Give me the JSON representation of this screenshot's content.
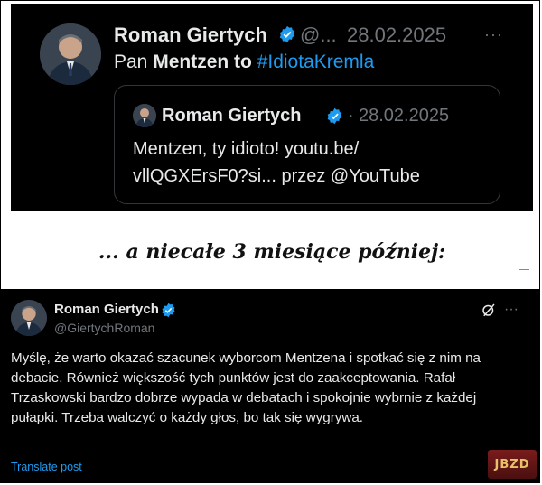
{
  "top_tweet": {
    "name": "Roman Giertych",
    "handle": "@...",
    "date": "28.02.2025",
    "more": "···",
    "text_prefix": "Pan ",
    "text_bold": "Mentzen to ",
    "text_hashtag": "#IdiotaKremla",
    "quote": {
      "name": "Roman Giertych",
      "separator": "·",
      "date": "28.02.2025",
      "line1": "Mentzen, ty idioto!  youtu.be/",
      "line2": "vllQGXErsF0?si... przez @YouTube"
    }
  },
  "banner": {
    "text": "... a niecałe 3 miesiące później:"
  },
  "bottom_tweet": {
    "name": "Roman Giertych",
    "handle": "@GiertychRoman",
    "more": "···",
    "text": "Myślę, że warto okazać szacunek wyborcom Mentzena i spotkać się z nim na debacie. Również większość tych punktów jest do zaakceptowania. Rafał Trzaskowski bardzo dobrze wypada w debatach i spokojnie wybrnie z każdej pułapki. Trzeba walczyć o każdy głos, bo tak się wygrywa.",
    "translate": "Translate post"
  },
  "watermark": "JBZD",
  "colors": {
    "background": "#000000",
    "text": "#e7e9ea",
    "muted": "#71767b",
    "link": "#1d9bf0",
    "verified": "#1d9bf0"
  },
  "icons": [
    "verified-badge-icon",
    "more-icon",
    "grok-icon"
  ]
}
